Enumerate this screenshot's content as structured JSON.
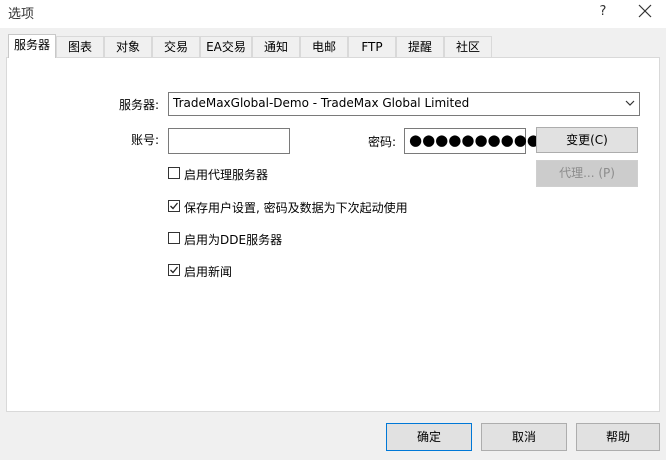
{
  "window": {
    "title": "选项",
    "help_glyph": "?"
  },
  "tabs": [
    {
      "label": "服务器",
      "active": true
    },
    {
      "label": "图表",
      "active": false
    },
    {
      "label": "对象",
      "active": false
    },
    {
      "label": "交易",
      "active": false
    },
    {
      "label": "EA交易",
      "active": false
    },
    {
      "label": "通知",
      "active": false
    },
    {
      "label": "电邮",
      "active": false
    },
    {
      "label": "FTP",
      "active": false
    },
    {
      "label": "提醒",
      "active": false
    },
    {
      "label": "社区",
      "active": false
    }
  ],
  "server": {
    "label": "服务器:",
    "selected": "TradeMaxGlobal-Demo - TradeMax Global Limited"
  },
  "account": {
    "label": "账号:",
    "value": ""
  },
  "password": {
    "label": "密码:",
    "masked": "●●●●●●●●●●●"
  },
  "buttons": {
    "change": "变更(C)",
    "proxy": "代理... (P)",
    "ok": "确定",
    "cancel": "取消",
    "help": "帮助"
  },
  "checkboxes": [
    {
      "label": "启用代理服务器",
      "checked": false
    },
    {
      "label": "保存用户设置, 密码及数据为下次起动使用",
      "checked": true
    },
    {
      "label": "启用为DDE服务器",
      "checked": false
    },
    {
      "label": "启用新闻",
      "checked": true
    }
  ]
}
